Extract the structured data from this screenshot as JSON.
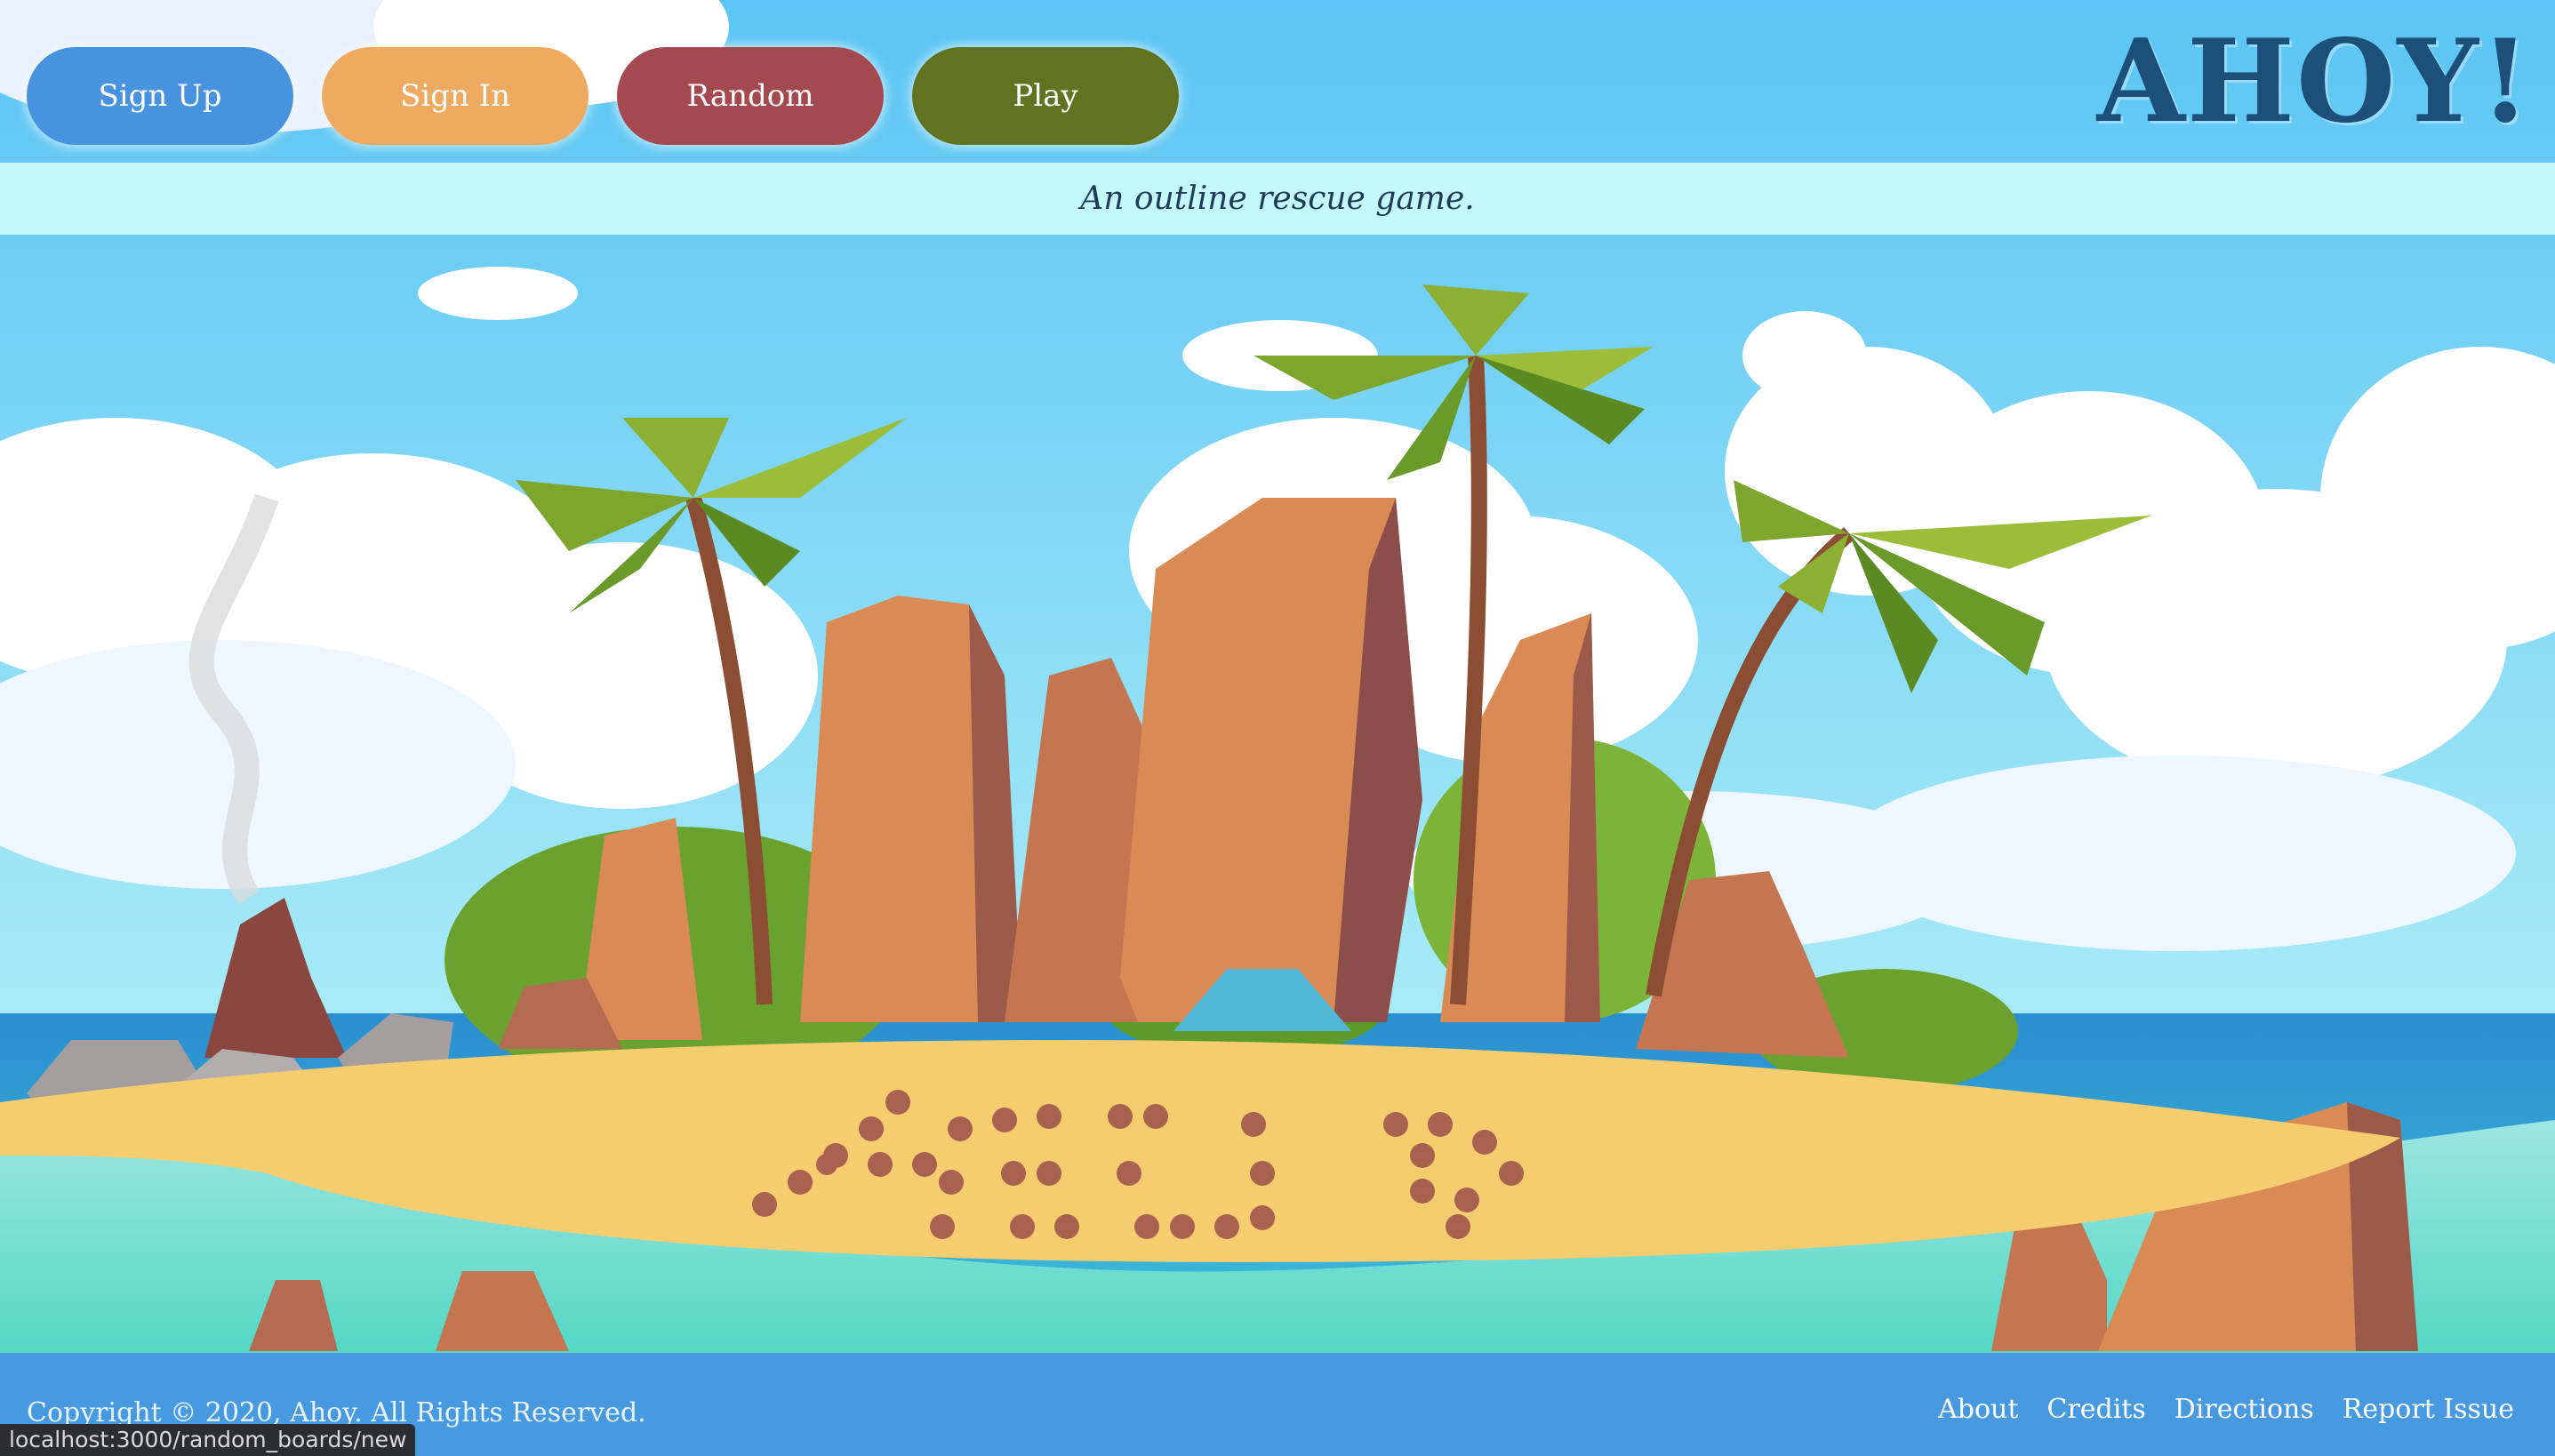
{
  "nav": {
    "buttons": [
      {
        "label": "Sign Up",
        "color": "#4893e0"
      },
      {
        "label": "Sign In",
        "color": "#efaa61"
      },
      {
        "label": "Random",
        "color": "#a54950"
      },
      {
        "label": "Play",
        "color": "#607320"
      }
    ]
  },
  "brand": {
    "logo_text": "AHOY!",
    "tagline": "An outline rescue game."
  },
  "hero": {
    "illustration": "desert-island-help-stones",
    "sand_message": "HELP"
  },
  "footer": {
    "copyright": "Copyright © 2020, Ahoy. All Rights Reserved.",
    "links": [
      "About",
      "Credits",
      "Directions",
      "Report Issue"
    ]
  },
  "status_bar": {
    "url": "localhost:3000/random_boards/new"
  },
  "colors": {
    "sky": "#5fc8f5",
    "tagline_bar": "#c4f9fb",
    "footer": "#4799e0",
    "logo": "#1d5079"
  }
}
